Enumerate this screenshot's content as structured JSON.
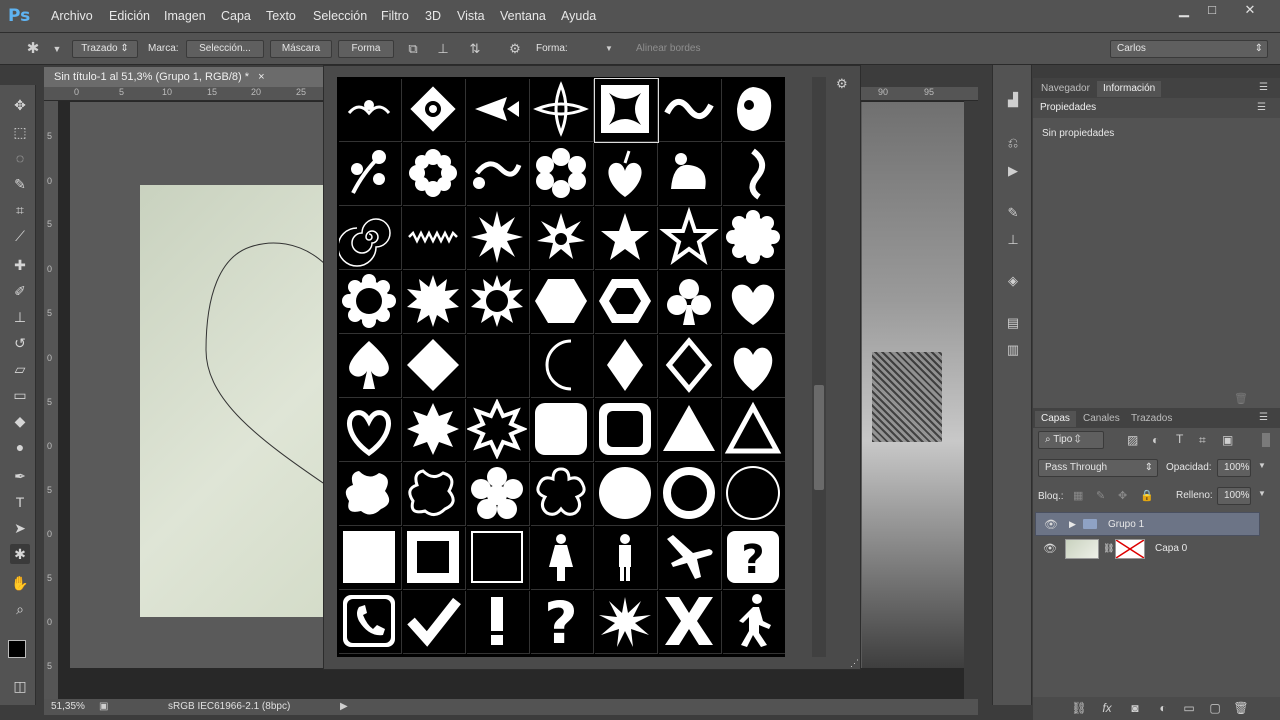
{
  "app": {
    "logo": "Ps"
  },
  "menu": [
    "Archivo",
    "Edición",
    "Imagen",
    "Capa",
    "Texto",
    "Selección",
    "Filtro",
    "3D",
    "Vista",
    "Ventana",
    "Ayuda"
  ],
  "options": {
    "mode": "Trazado",
    "marca_label": "Marca:",
    "seleccion": "Selección...",
    "mascara": "Máscara",
    "forma_btn": "Forma",
    "forma_label": "Forma:",
    "alinear": "Alinear bordes",
    "workspace": "Carlos"
  },
  "document": {
    "tab_title": "Sin título-1 al 51,3% (Grupo 1, RGB/8) *",
    "zoom": "51,35%",
    "profile": "sRGB IEC61966-2.1 (8bpc)",
    "ruler_h": [
      "0",
      "5",
      "10",
      "15",
      "20",
      "25",
      "90",
      "95"
    ],
    "ruler_v": [
      "5",
      "0",
      "5",
      "0",
      "5",
      "0",
      "5",
      "0",
      "5",
      "0",
      "5",
      "0",
      "5"
    ]
  },
  "panels": {
    "top_tabs": [
      "Navegador",
      "Información"
    ],
    "properties_title": "Propiedades",
    "no_properties": "Sin propiedades",
    "layers_tabs": [
      "Capas",
      "Canales",
      "Trazados"
    ],
    "filter_kind": "Tipo",
    "blend_mode": "Pass Through",
    "opacity_label": "Opacidad:",
    "opacity": "100%",
    "lock_label": "Bloq.:",
    "fill_label": "Relleno:",
    "fill": "100%",
    "layers": [
      {
        "name": "Grupo 1",
        "type": "group"
      },
      {
        "name": "Capa 0",
        "type": "layer"
      }
    ]
  },
  "shapes": [
    "ornament-1",
    "ornament-2",
    "ornament-3",
    "ornament-4",
    "ornament-5",
    "ornament-6",
    "ornament-7",
    "floral-1",
    "flower-1",
    "floral-2",
    "flower-2",
    "leaf-heart",
    "floral-3",
    "floral-4",
    "spiral",
    "zigzag",
    "star-burst-12",
    "star-burst-8",
    "star-5",
    "star-5-outline",
    "scallop",
    "scallop-circle",
    "seal-1",
    "seal-2",
    "hexagon",
    "hexagon-outline",
    "club",
    "heart",
    "spade",
    "diamond",
    "moon",
    "moon-outline",
    "diamond-tall",
    "diamond-outline",
    "heart-2",
    "heart-outline",
    "star-8",
    "star-8-outline",
    "rounded-square",
    "rounded-square-outline",
    "triangle",
    "triangle-outline",
    "blob",
    "blob-outline",
    "flower-5",
    "flower-5-outline",
    "circle",
    "ring",
    "circle-frame",
    "square",
    "square-frame",
    "square-frame-thin",
    "woman",
    "man",
    "airplane",
    "question-box",
    "phone-box",
    "checkmark",
    "exclamation",
    "question",
    "starburst",
    "x",
    "walker"
  ]
}
